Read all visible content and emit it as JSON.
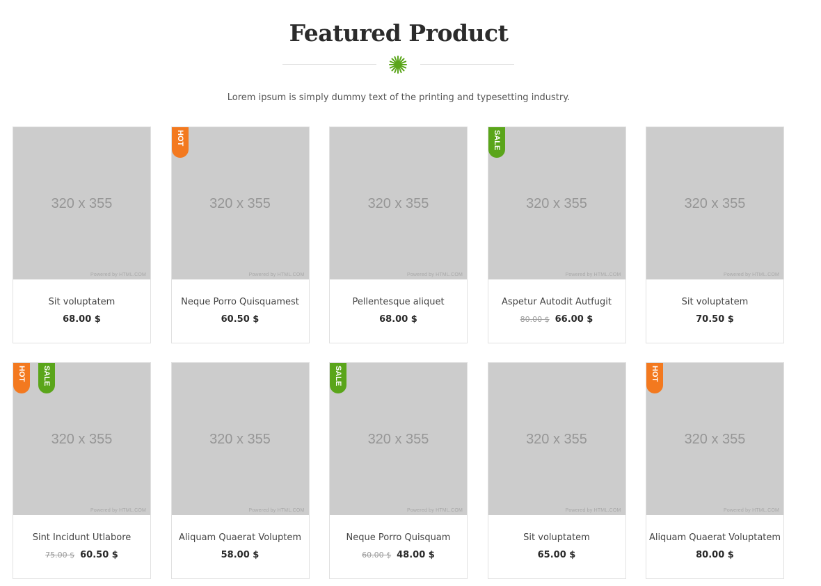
{
  "header": {
    "title": "Featured Product",
    "subtitle": "Lorem ipsum is simply dummy text of the printing and typesetting industry."
  },
  "colors": {
    "hot": "#f3791f",
    "sale": "#5aa51a",
    "placeholder_bg": "#cccccc",
    "accent_star": "#5aa51a"
  },
  "placeholder": {
    "size_label": "320 x 355",
    "powered": "Powered by HTML.COM"
  },
  "badges": {
    "hot": "HOT",
    "sale": "SALE"
  },
  "products": [
    {
      "name": "Sit voluptatem",
      "price": "68.00 $",
      "old_price": "",
      "badges": []
    },
    {
      "name": "Neque Porro Quisquamest",
      "price": "60.50 $",
      "old_price": "",
      "badges": [
        "hot"
      ]
    },
    {
      "name": "Pellentesque aliquet",
      "price": "68.00 $",
      "old_price": "",
      "badges": []
    },
    {
      "name": "Aspetur Autodit Autfugit",
      "price": "66.00 $",
      "old_price": "80.00 $",
      "badges": [
        "sale"
      ]
    },
    {
      "name": "Sit voluptatem",
      "price": "70.50 $",
      "old_price": "",
      "badges": []
    },
    {
      "name": "Sint Incidunt Utlabore",
      "price": "60.50 $",
      "old_price": "75.00 $",
      "badges": [
        "hot",
        "sale"
      ]
    },
    {
      "name": "Aliquam Quaerat Voluptem",
      "price": "58.00 $",
      "old_price": "",
      "badges": []
    },
    {
      "name": "Neque Porro Quisquam",
      "price": "48.00 $",
      "old_price": "60.00 $",
      "badges": [
        "sale"
      ]
    },
    {
      "name": "Sit voluptatem",
      "price": "65.00 $",
      "old_price": "",
      "badges": []
    },
    {
      "name": "Aliquam Quaerat Voluptatem",
      "price": "80.00 $",
      "old_price": "",
      "badges": [
        "hot"
      ]
    }
  ]
}
